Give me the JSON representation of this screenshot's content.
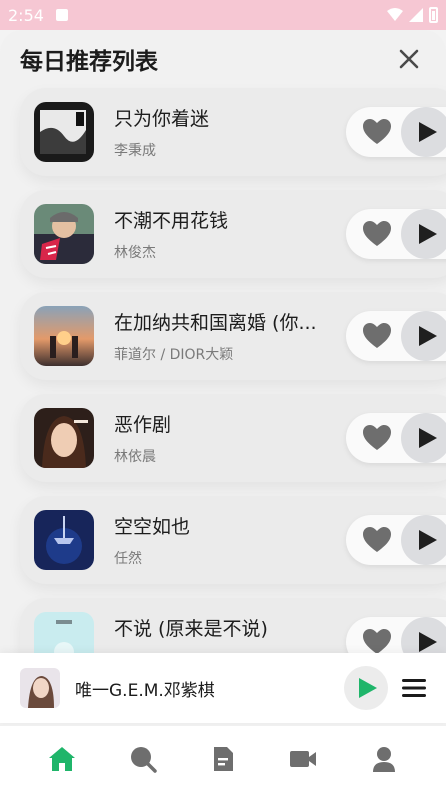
{
  "status_bar": {
    "time": "2:54",
    "icons": [
      "app-notification-icon",
      "wifi-icon",
      "signal-icon",
      "battery-icon"
    ]
  },
  "panel": {
    "title": "每日推荐列表",
    "close_icon": "close-icon"
  },
  "songs": [
    {
      "title": "只为你着迷",
      "artist": "李秉成"
    },
    {
      "title": "不潮不用花钱",
      "artist": "林俊杰"
    },
    {
      "title": "在加纳共和国离婚 (你...",
      "artist": "菲道尔 / DIOR大颖"
    },
    {
      "title": "恶作剧",
      "artist": "林依晨"
    },
    {
      "title": "空空如也",
      "artist": "任然"
    },
    {
      "title": "不说 (原来是不说)",
      "artist": ""
    }
  ],
  "now_playing": {
    "title": "唯一G.E.M.邓紫棋",
    "play_icon": "play-icon",
    "menu_icon": "menu-icon"
  },
  "bottom_nav": {
    "items": [
      "home-icon",
      "search-icon",
      "document-icon",
      "video-icon",
      "profile-icon"
    ],
    "active": "home-icon"
  },
  "colors": {
    "status_bar": "#f6c7d3",
    "accent_green": "#1fb56a",
    "icon_gray": "#6e6e6e"
  }
}
